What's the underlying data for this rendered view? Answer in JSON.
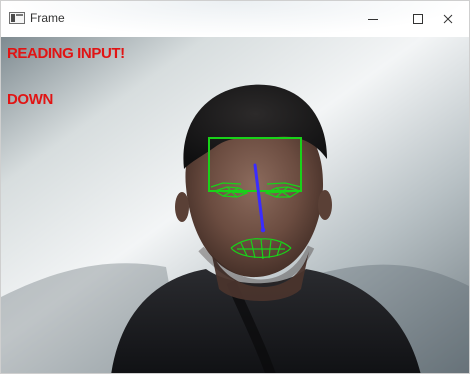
{
  "window": {
    "title": "Frame"
  },
  "titlebar": {
    "minimize_glyph": "—",
    "maximize_glyph": "□",
    "close_glyph": "✕"
  },
  "overlay": {
    "status_line_1": "READING  INPUT!",
    "status_line_2": "DOWN",
    "text_color": "#e11414",
    "box_color": "#19d219",
    "direction_line_color": "#3a2cff"
  },
  "icons": {
    "app": "window-app-icon",
    "minimize": "minimize-icon",
    "maximize": "maximize-icon",
    "close": "close-icon"
  }
}
